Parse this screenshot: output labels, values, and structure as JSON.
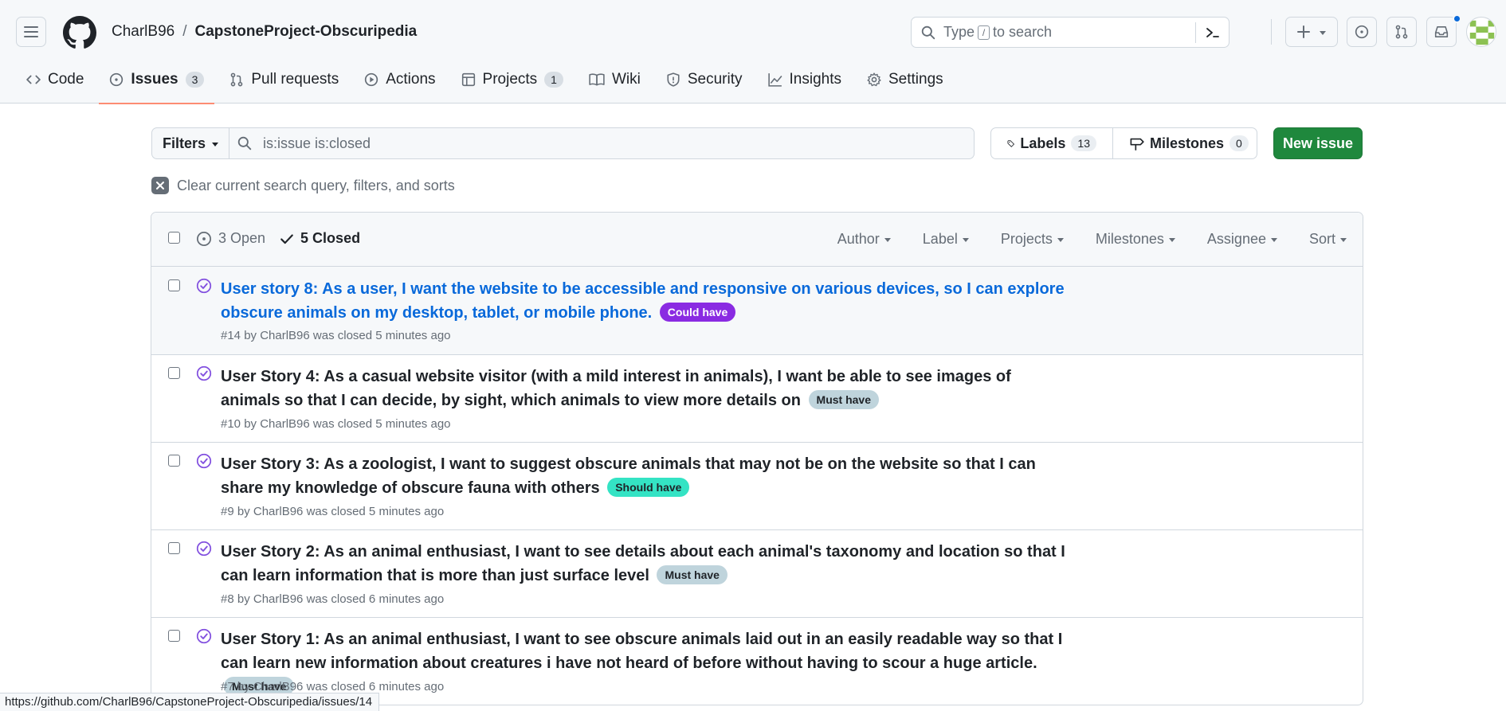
{
  "header": {
    "owner": "CharlB96",
    "separator": "/",
    "repo": "CapstoneProject-Obscuripedia",
    "search_before": "Type",
    "search_key": "/",
    "search_after": "to search"
  },
  "tabs": [
    {
      "label": "Code",
      "icon": "code-icon"
    },
    {
      "label": "Issues",
      "icon": "issue-opened-icon",
      "count": "3",
      "active": true
    },
    {
      "label": "Pull requests",
      "icon": "git-pull-request-icon"
    },
    {
      "label": "Actions",
      "icon": "play-icon"
    },
    {
      "label": "Projects",
      "icon": "table-icon",
      "count": "1"
    },
    {
      "label": "Wiki",
      "icon": "book-icon"
    },
    {
      "label": "Security",
      "icon": "shield-icon"
    },
    {
      "label": "Insights",
      "icon": "graph-icon"
    },
    {
      "label": "Settings",
      "icon": "gear-icon"
    }
  ],
  "toolbar": {
    "filters_label": "Filters",
    "query": "is:issue is:closed",
    "labels_label": "Labels",
    "labels_count": "13",
    "milestones_label": "Milestones",
    "milestones_count": "0",
    "new_issue_label": "New issue",
    "clear_label": "Clear current search query, filters, and sorts"
  },
  "list_header": {
    "open_label": "3 Open",
    "closed_label": "5 Closed",
    "sorters": [
      "Author",
      "Label",
      "Projects",
      "Milestones",
      "Assignee",
      "Sort"
    ]
  },
  "issues": [
    {
      "title": "User story 8: As a user, I want the website to be accessible and responsive on various devices, so I can explore obscure animals on my desktop, tablet, or mobile phone.",
      "label": "Could have",
      "label_color": "#8a2be2",
      "label_text_color": "#ffffff",
      "meta": "#14 by CharlB96 was closed 5 minutes ago"
    },
    {
      "title": "User Story 4: As a casual website visitor (with a mild interest in animals), I want be able to see images of animals so that I can decide, by sight, which animals to view more details on",
      "label": "Must have",
      "label_color": "#bfd4dc",
      "label_text_color": "#1f2328",
      "meta": "#10 by CharlB96 was closed 5 minutes ago"
    },
    {
      "title": "User Story 3: As a zoologist, I want to suggest obscure animals that may not be on the website so that I can share my knowledge of obscure fauna with others",
      "label": "Should have",
      "label_color": "#34e3c4",
      "label_text_color": "#1f2328",
      "meta": "#9 by CharlB96 was closed 5 minutes ago"
    },
    {
      "title": "User Story 2: As an animal enthusiast, I want to see details about each animal's taxonomy and location so that I can learn information that is more than just surface level",
      "label": "Must have",
      "label_color": "#bfd4dc",
      "label_text_color": "#1f2328",
      "meta": "#8 by CharlB96 was closed 6 minutes ago"
    },
    {
      "title": "User Story 1: As an animal enthusiast, I want to see obscure animals laid out in an easily readable way so that I can learn new information about creatures i have not heard of before without having to scour a huge article.",
      "label": "Must have",
      "label_color": "#bfd4dc",
      "label_text_color": "#1f2328",
      "meta": "#7 by CharlB96 was closed 6 minutes ago"
    }
  ],
  "status_url": "https://github.com/CharlB96/CapstoneProject-Obscuripedia/issues/14",
  "colors": {
    "accent": "#0969da",
    "success": "#1f883d",
    "closed_icon": "#8250df",
    "tab_underline": "#fd8c73"
  }
}
